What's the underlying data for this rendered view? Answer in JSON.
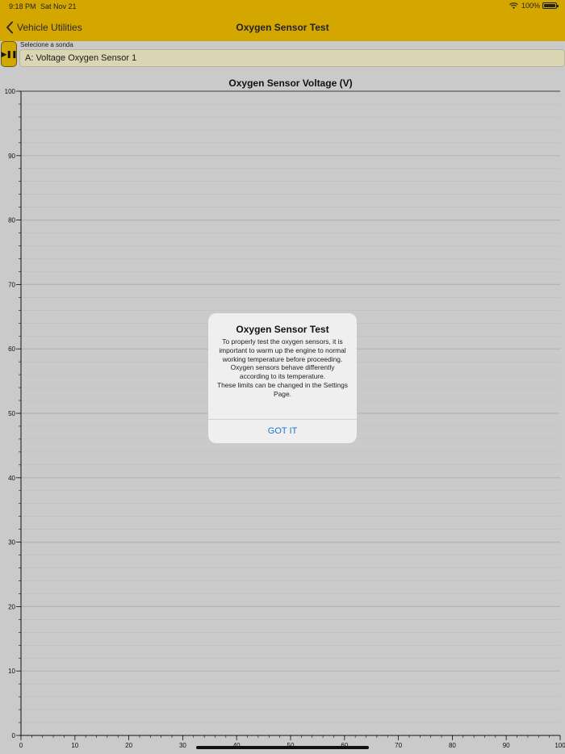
{
  "status_bar": {
    "time": "9:18 PM",
    "date": "Sat Nov 21",
    "battery": "100%",
    "icons": [
      "wifi-icon",
      "battery-icon"
    ]
  },
  "nav": {
    "back_label": "Vehicle Utilities",
    "back_icon": "chevron-left-icon",
    "title": "Oxygen Sensor Test"
  },
  "controls": {
    "play_pause_icon": "play-pause-icon",
    "play_pause_glyph": "▶❚❚",
    "select_label": "Selecione a sonda",
    "selected_sensor": "A: Voltage Oxygen Sensor 1"
  },
  "chart_data": {
    "type": "line",
    "title": "Oxygen Sensor Voltage (V)",
    "xlabel": "",
    "ylabel": "",
    "xlim": [
      0,
      100
    ],
    "ylim": [
      0,
      100
    ],
    "x_ticks": [
      0,
      10,
      20,
      30,
      40,
      50,
      60,
      70,
      80,
      90,
      100
    ],
    "y_ticks": [
      0,
      10,
      20,
      30,
      40,
      50,
      60,
      70,
      80,
      90,
      100
    ],
    "grid": true,
    "series": []
  },
  "alert": {
    "title": "Oxygen Sensor Test",
    "message_lines": [
      "To properly test the oxygen sensors, it is important to warm up the engine to normal working temperature before proceeding. Oxygen sensors behave differently according to its temperature.",
      "These limits can be changed in the Settings Page."
    ],
    "button_label": "GOT IT"
  },
  "colors": {
    "header": "#d4a700",
    "background": "#cacaca",
    "button_text": "#1677d2"
  }
}
